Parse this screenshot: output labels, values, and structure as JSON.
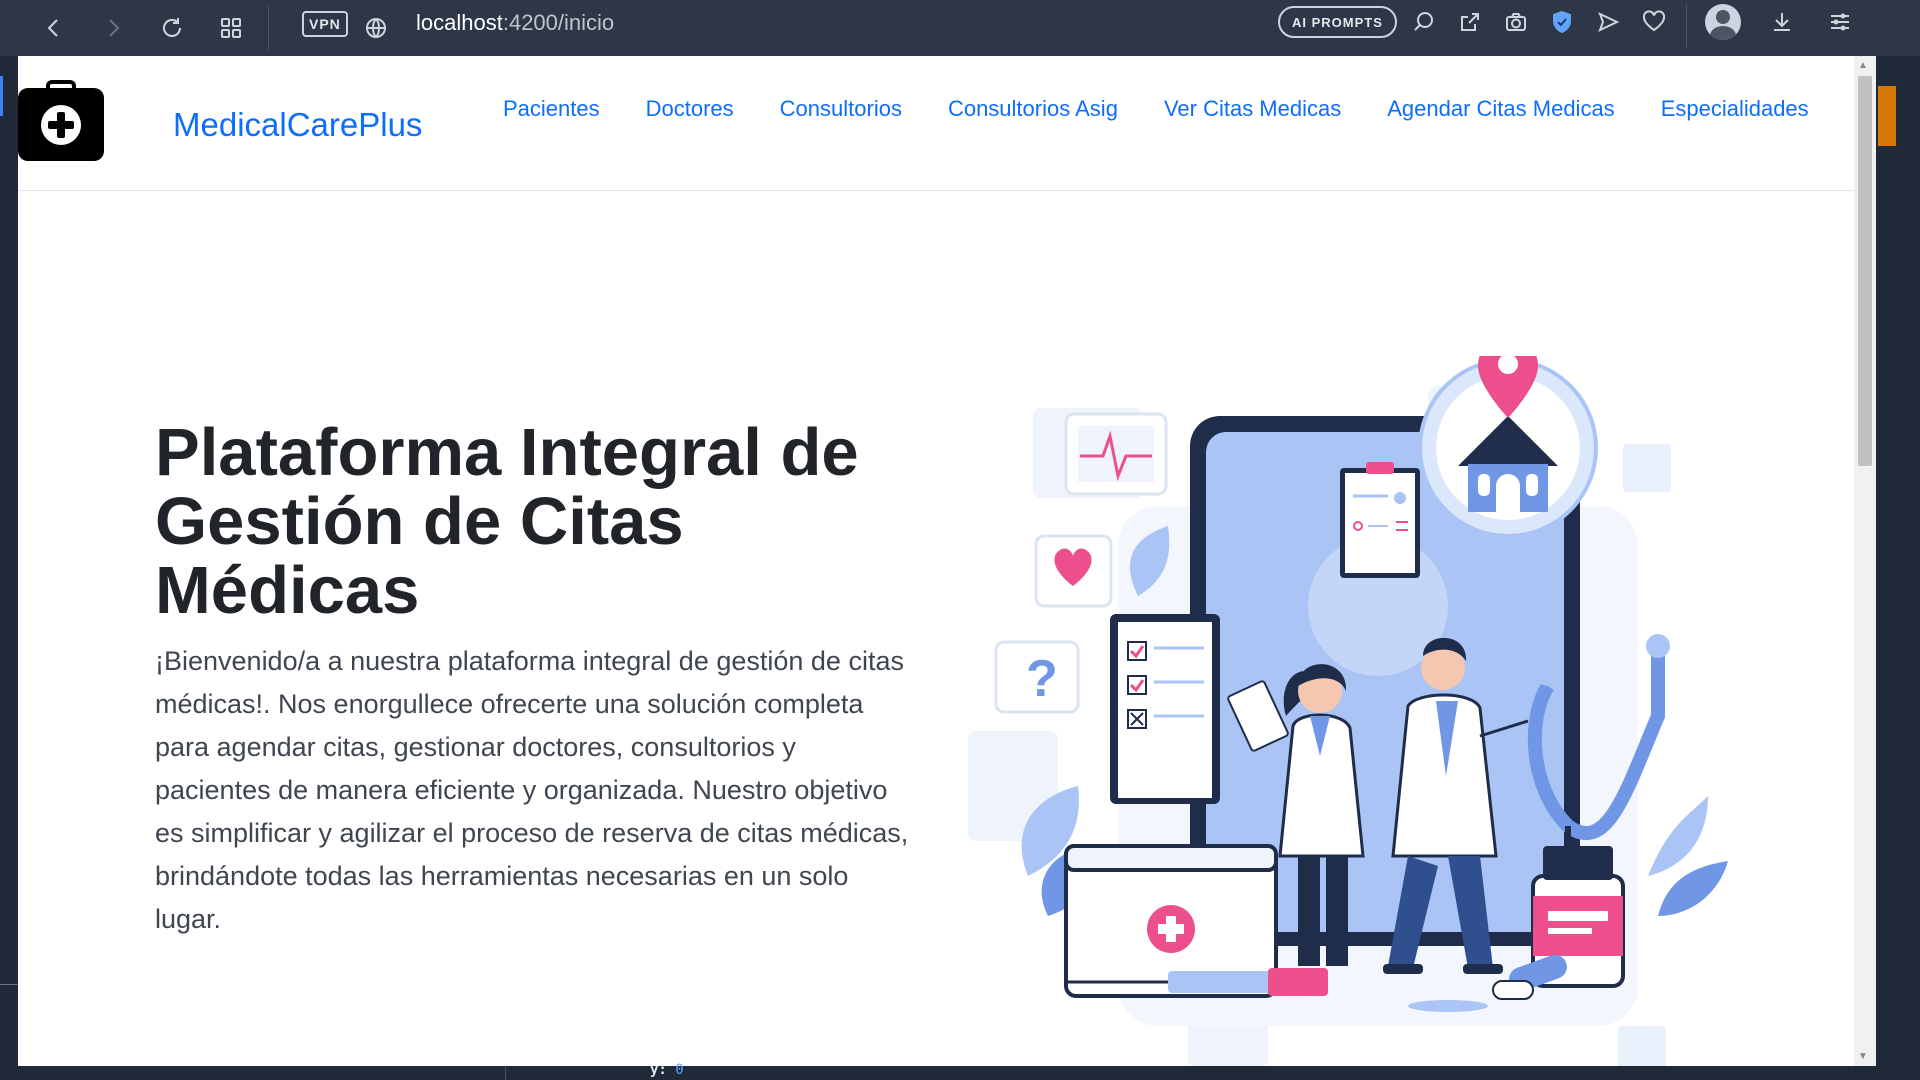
{
  "browser": {
    "vpn_label": "VPN",
    "url_host": "localhost",
    "url_path": ":4200/inicio",
    "ai_prompts_label": "AI PROMPTS"
  },
  "site": {
    "brand": "MedicalCarePlus",
    "nav": [
      {
        "label": "Pacientes"
      },
      {
        "label": "Doctores"
      },
      {
        "label": "Consultorios"
      },
      {
        "label": "Consultorios Asig"
      },
      {
        "label": "Ver Citas Medicas"
      },
      {
        "label": "Agendar Citas Medicas"
      },
      {
        "label": "Especialidades"
      }
    ]
  },
  "hero": {
    "title": "Plataforma Integral de Gestión de Citas Médicas",
    "text": "¡Bienvenido/a a nuestra plataforma integral de gestión de citas médicas!. Nos enorgullece ofrecerte una solución completa para agendar citas, gestionar doctores, consultorios y pacientes de manera eficiente y organizada. Nuestro objetivo es simplificar y agilizar el proceso de reserva de citas médicas, brindándote todas las herramientas necesarias en un solo lugar."
  },
  "editor_fragment": {
    "text": "y: ",
    "value": "0"
  },
  "colors": {
    "link": "#0d6efd",
    "heading": "#212529",
    "chrome": "#2d3748",
    "illustration_blue": "#a9c4f5",
    "illustration_pink": "#ec4f8b",
    "illustration_navy": "#1f2d4a"
  },
  "icons": [
    "back-icon",
    "forward-icon",
    "reload-icon",
    "tabs-grid-icon",
    "globe-icon",
    "search-page-icon",
    "edit-share-icon",
    "camera-icon",
    "shield-icon",
    "send-icon",
    "heart-icon",
    "avatar-icon",
    "download-icon",
    "menu-icon",
    "medical-kit-logo"
  ]
}
